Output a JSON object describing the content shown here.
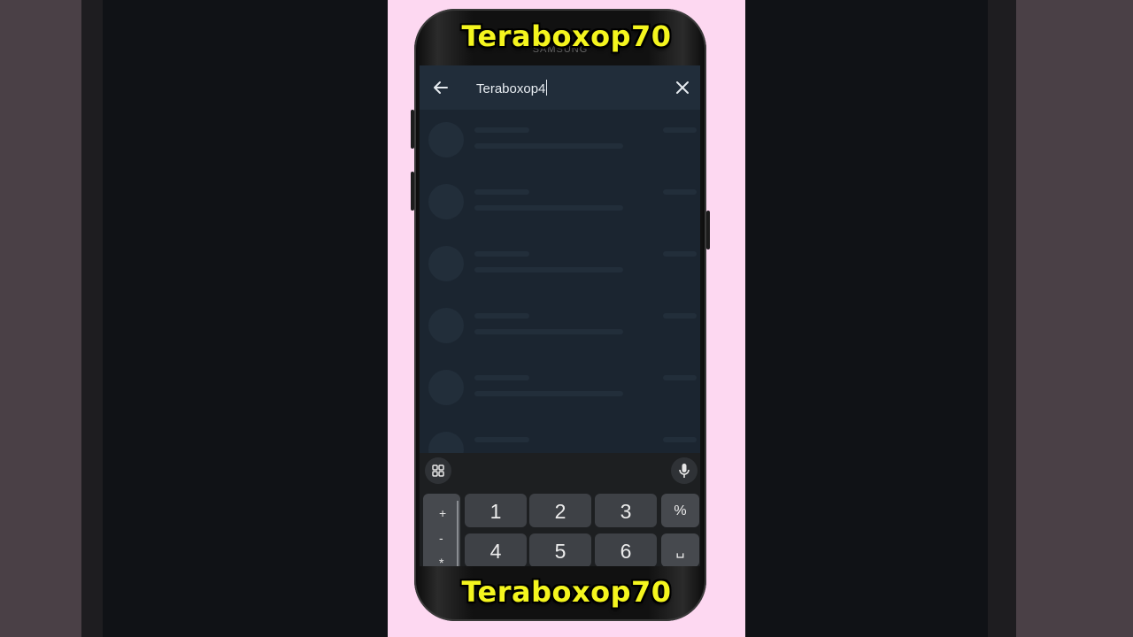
{
  "overlay": {
    "top_title": "Teraboxop70",
    "bottom_title": "Teraboxop70"
  },
  "phone": {
    "brand": "SAMSUNG"
  },
  "search": {
    "value": "Teraboxop4",
    "back_icon": "arrow-left-icon",
    "clear_icon": "close-icon"
  },
  "results": {
    "state": "loading",
    "skeleton_rows": 6
  },
  "keyboard": {
    "toolbar": {
      "left_icon": "grid-icon",
      "right_icon": "microphone-icon"
    },
    "symbols": [
      "+",
      "-",
      "*"
    ],
    "row1": [
      "1",
      "2",
      "3",
      "%"
    ],
    "row2": [
      "4",
      "5",
      "6",
      "␣"
    ]
  }
}
